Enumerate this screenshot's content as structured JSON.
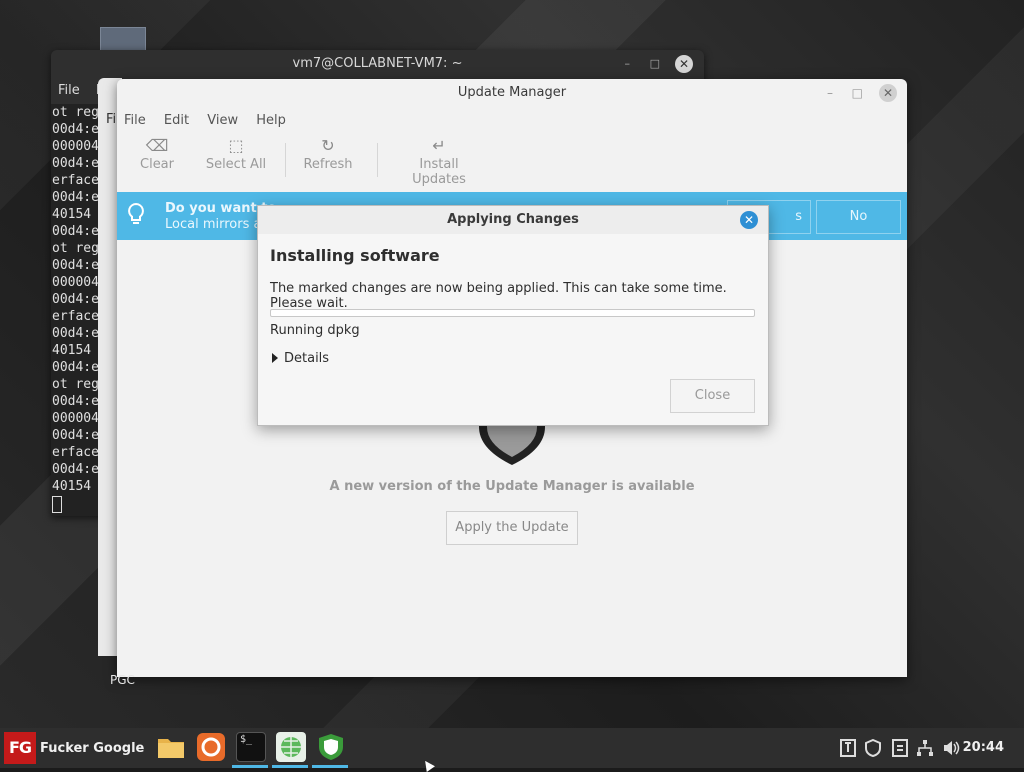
{
  "desktop": {
    "icon_label": "PGC"
  },
  "terminal": {
    "title": "vm7@COLLABNET-VM7: ~",
    "minimize": "–",
    "maximize": "□",
    "close": "✕",
    "menu_file": "File",
    "menu_partial": "E",
    "lines": [
      "ot reg",
      "00d4:e",
      "000004",
      "00d4:e",
      "erface",
      "00d4:e",
      "40154",
      "00d4:e",
      "ot reg",
      "00d4:e",
      "000004",
      "00d4:e",
      "erface",
      "00d4:e",
      "40154",
      "00d4:e",
      "ot reg",
      "00d4:e",
      "000004",
      "00d4:e",
      "erface",
      "00d4:e",
      "40154"
    ]
  },
  "back_window": {
    "menu_partial": "Fi"
  },
  "update_manager": {
    "title": "Update Manager",
    "minimize": "–",
    "maximize": "□",
    "close": "✕",
    "menu": [
      "File",
      "Edit",
      "View",
      "Help"
    ],
    "toolbar": {
      "clear": "Clear",
      "select_all": "Select All",
      "refresh": "Refresh",
      "install": "Install Updates"
    },
    "banner": {
      "line1": "Do you want to",
      "line2": "Local mirrors a",
      "btn_partial": "s",
      "btn_no": "No"
    },
    "new_version_text": "A new version of the Update Manager is available",
    "apply_button": "Apply the Update"
  },
  "dialog": {
    "title": "Applying Changes",
    "close": "✕",
    "heading": "Installing software",
    "message": "The marked changes are now being applied. This can take some time. Please wait.",
    "progress": 0,
    "status": "Running dpkg",
    "details_label": "Details",
    "close_button": "Close"
  },
  "taskbar": {
    "menu_logo": "FG",
    "menu_label": "Fucker Google",
    "clock": "20:44",
    "accent": "#4fb8e6",
    "apps": [
      "folder-icon",
      "firefox-icon",
      "terminal-icon",
      "network-icon",
      "update-shield-icon"
    ],
    "terminal_glyph": "$_"
  }
}
